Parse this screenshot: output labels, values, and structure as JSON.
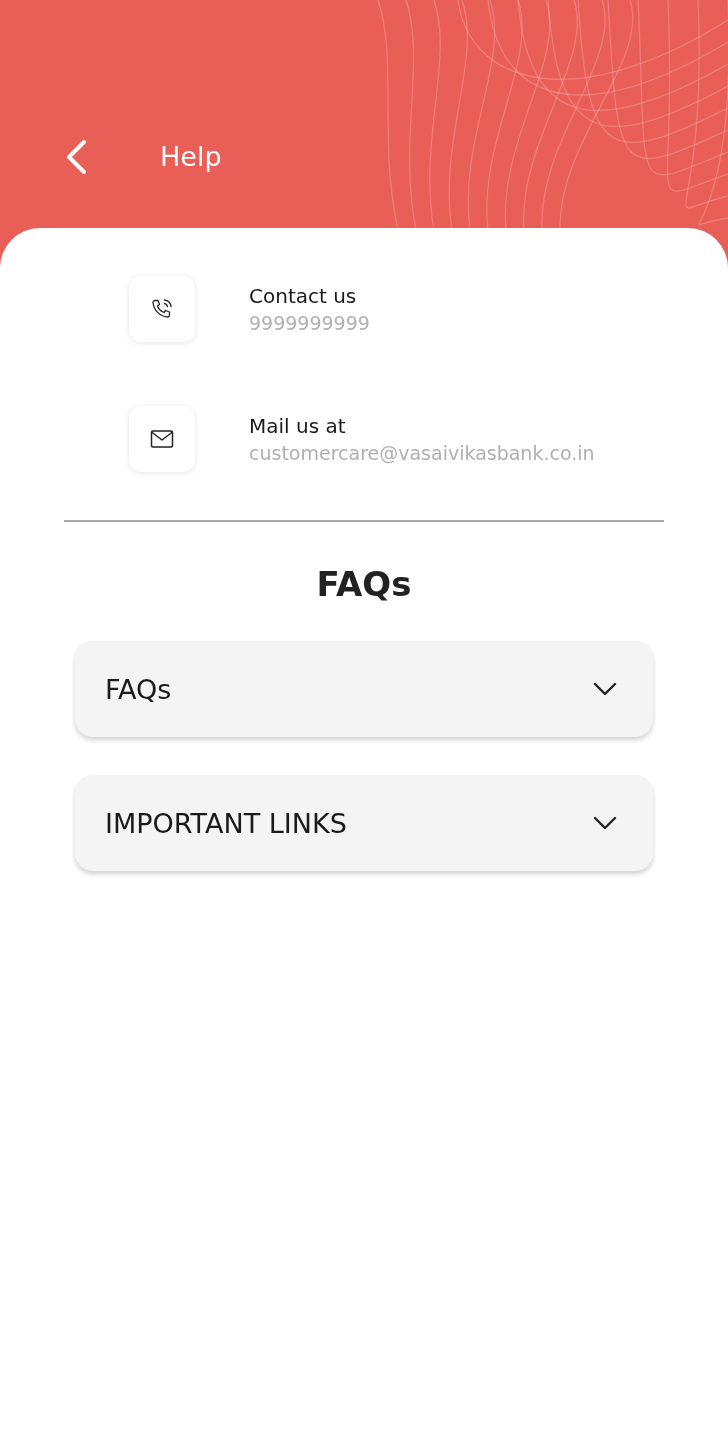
{
  "header": {
    "title": "Help"
  },
  "contacts": [
    {
      "kind": "phone",
      "label": "Contact us",
      "value": "9999999999"
    },
    {
      "kind": "mail",
      "label": "Mail us at",
      "value": "customercare@vasaivikasbank.co.in"
    }
  ],
  "section_title": "FAQs",
  "accordions": [
    {
      "label": "FAQs",
      "expanded": false
    },
    {
      "label": "IMPORTANT LINKS",
      "expanded": false
    }
  ]
}
